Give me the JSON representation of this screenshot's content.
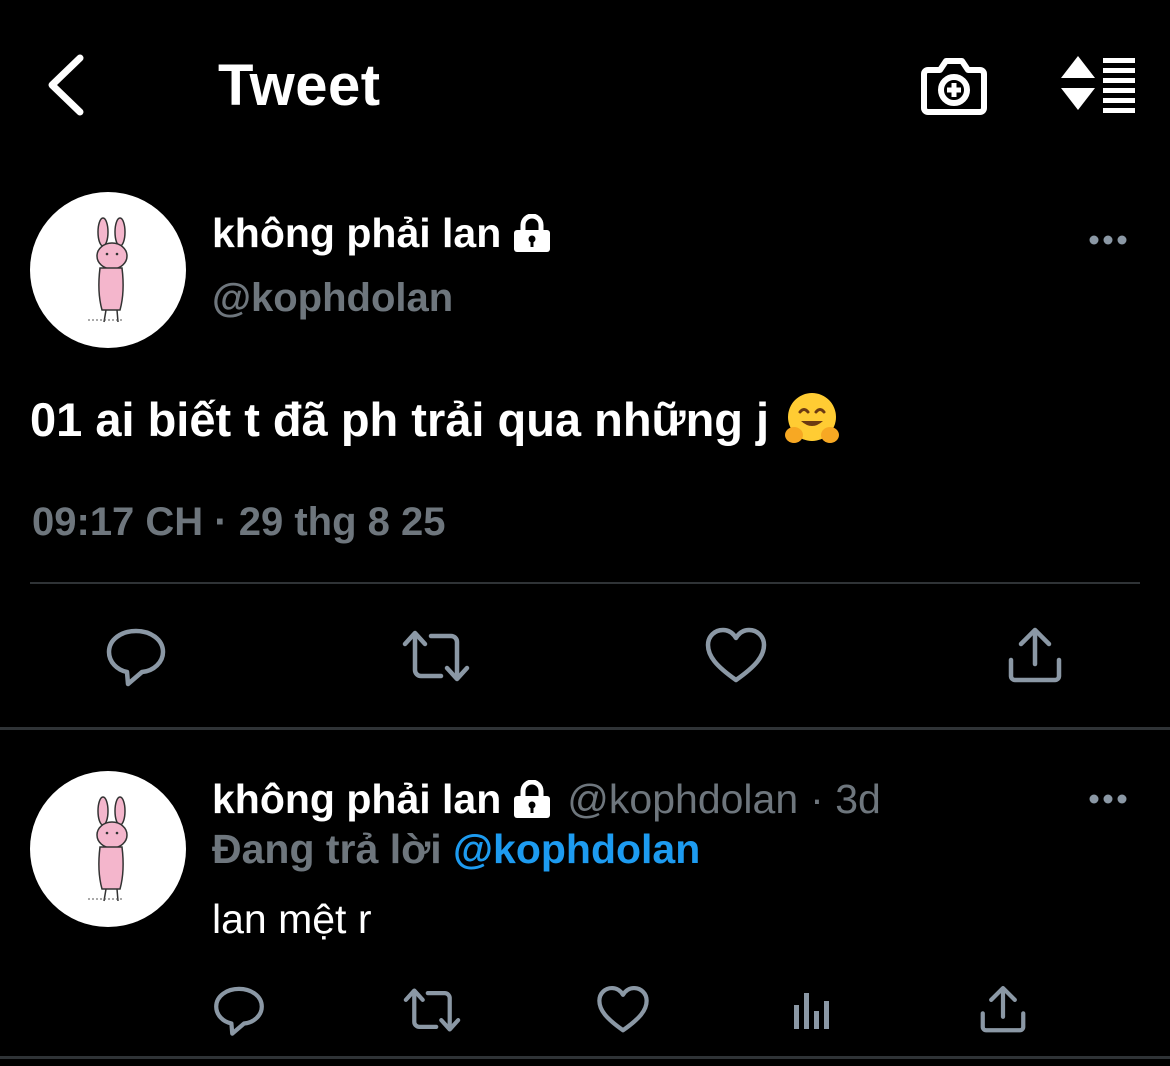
{
  "header": {
    "title": "Tweet",
    "back_icon": "chevron-left-icon",
    "camera_icon": "camera-plus-icon",
    "sort_icon": "sort-list-icon"
  },
  "tweet": {
    "display_name": "không phải lan",
    "handle": "@kophdolan",
    "text": "01 ai biết t đã ph trải qua những j",
    "emoji": "hugging-face-emoji",
    "timestamp": "09:17 CH · 29 thg 8 25",
    "actions": [
      "reply-icon",
      "retweet-icon",
      "like-icon",
      "share-icon"
    ]
  },
  "reply": {
    "display_name": "không phải lan",
    "handle": "@kophdolan",
    "time": "· 3d",
    "replying_label": "Đang trả lời",
    "replying_to": "@kophdolan",
    "text": "lan mệt r",
    "actions": [
      "reply-icon",
      "retweet-icon",
      "like-icon",
      "analytics-icon",
      "share-icon"
    ]
  },
  "colors": {
    "background": "#000000",
    "text": "#ffffff",
    "secondary": "#6e767d",
    "accent": "#1d9bf0",
    "divider": "#2f3336"
  }
}
